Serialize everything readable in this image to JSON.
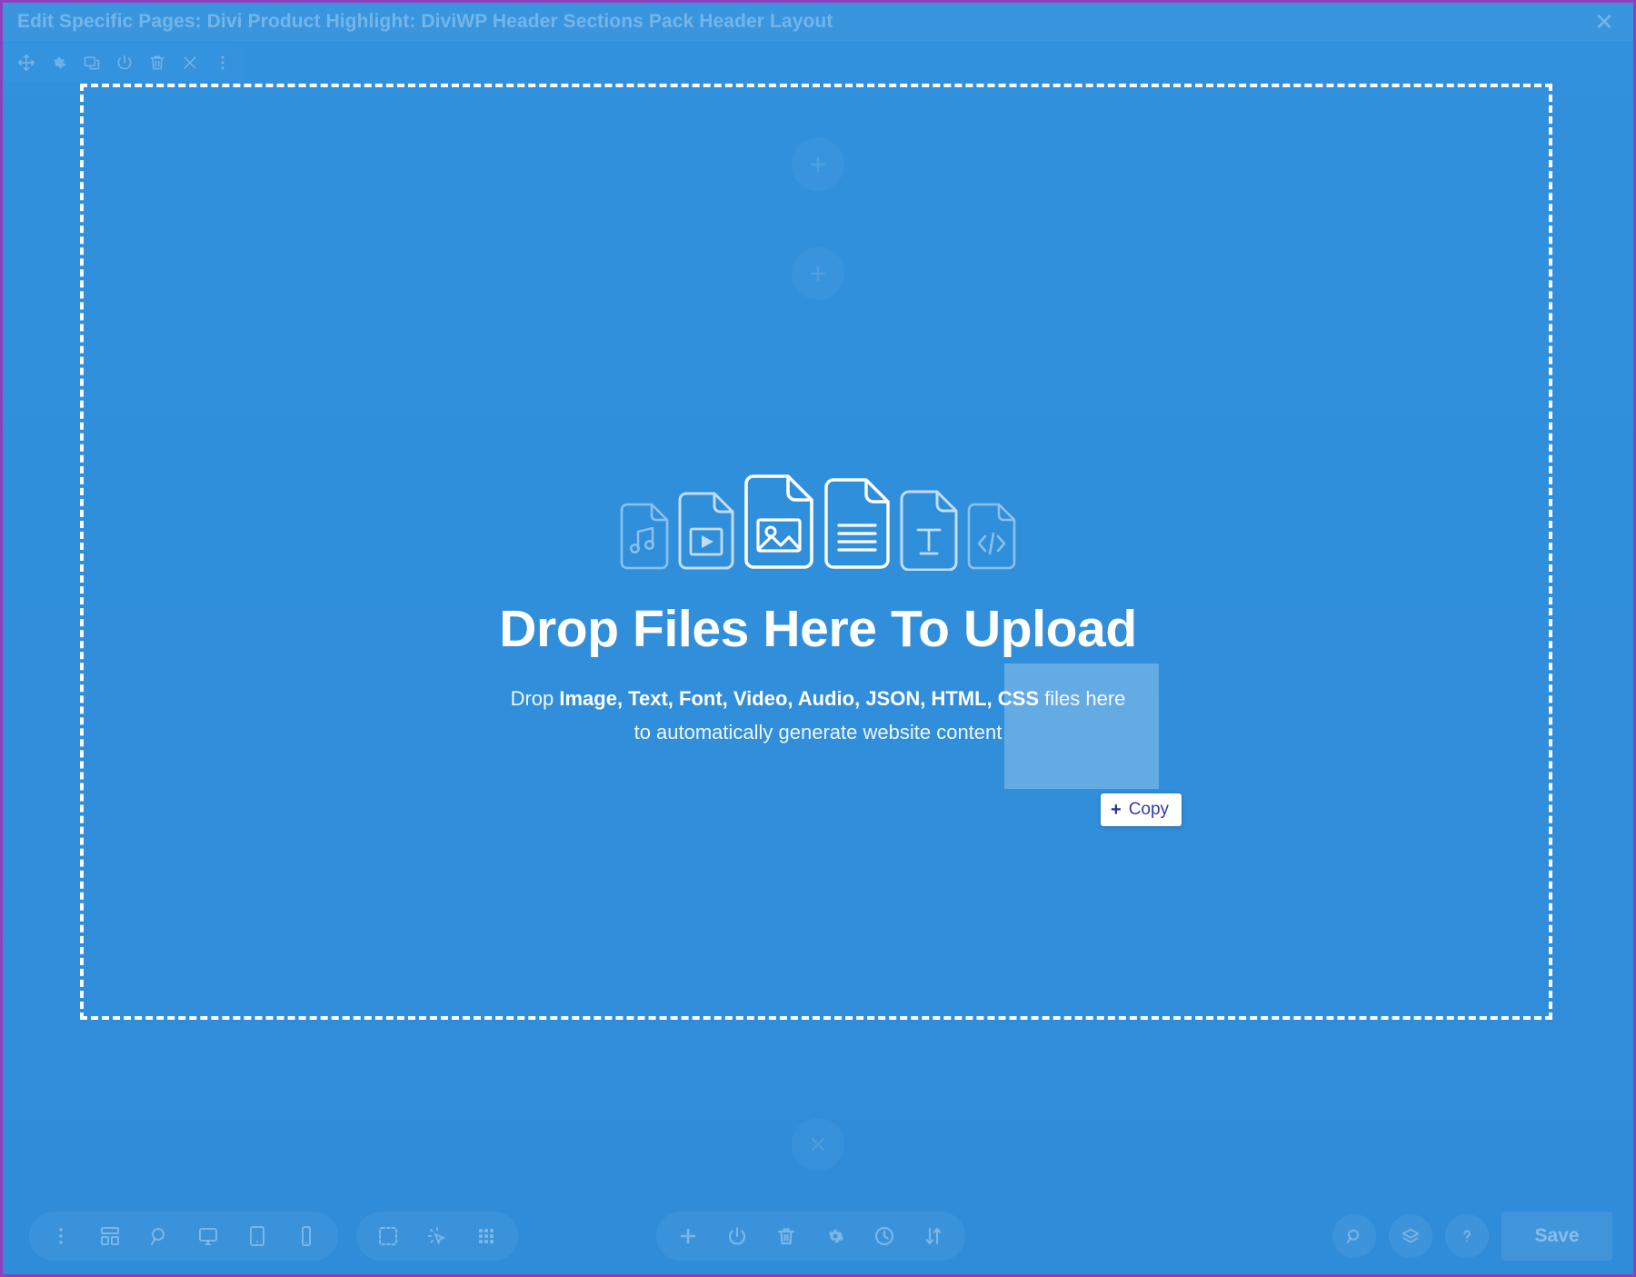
{
  "window": {
    "title": "Edit Specific Pages: Divi Product Highlight: DiviWP Header Sections Pack Header Layout",
    "close_label": "✕",
    "accent_outline_color": "#8f3fbd",
    "canvas_color": "#3291dd"
  },
  "module_toolbar": {
    "items": [
      {
        "name": "move-icon",
        "label": "Move"
      },
      {
        "name": "gear-icon",
        "label": "Settings"
      },
      {
        "name": "duplicate-icon",
        "label": "Duplicate"
      },
      {
        "name": "power-icon",
        "label": "Disable"
      },
      {
        "name": "trash-icon",
        "label": "Delete"
      },
      {
        "name": "close-icon",
        "label": "Close"
      },
      {
        "name": "more-icon",
        "label": "More Options"
      }
    ]
  },
  "drop_area": {
    "file_types": [
      {
        "name": "audio-file-icon",
        "label": "Audio"
      },
      {
        "name": "video-file-icon",
        "label": "Video"
      },
      {
        "name": "image-file-icon",
        "label": "Image"
      },
      {
        "name": "text-file-icon",
        "label": "Text"
      },
      {
        "name": "font-file-icon",
        "label": "Font"
      },
      {
        "name": "code-file-icon",
        "label": "Code"
      }
    ],
    "headline": "Drop Files Here To Upload",
    "subline_lead": "Drop ",
    "subline_formats": "Image, Text, Font, Video, Audio, JSON, HTML, CSS",
    "subline_tail": " files here",
    "subline_second": "to automatically generate website content",
    "formats": [
      "Image",
      "Text",
      "Font",
      "Video",
      "Audio",
      "JSON",
      "HTML",
      "CSS"
    ]
  },
  "drag_tooltip": {
    "plus": "+",
    "label": "Copy"
  },
  "hints": {
    "add_top": "+",
    "add_mid": "+",
    "remove_bottom": "✕"
  },
  "bottom_bar": {
    "view_group": [
      {
        "name": "more-vertical-icon",
        "label": "More"
      },
      {
        "name": "wireframe-icon",
        "label": "Wireframe View"
      },
      {
        "name": "zoom-icon",
        "label": "Zoom Out View"
      },
      {
        "name": "desktop-icon",
        "label": "Desktop View"
      },
      {
        "name": "tablet-icon",
        "label": "Tablet View"
      },
      {
        "name": "phone-icon",
        "label": "Phone View"
      }
    ],
    "select_group": [
      {
        "name": "multiselect-icon",
        "label": "Multiselect"
      },
      {
        "name": "click-mode-icon",
        "label": "Click Mode"
      },
      {
        "name": "grid-mode-icon",
        "label": "Grid Mode"
      }
    ],
    "action_group": [
      {
        "name": "add-icon",
        "label": "Add Section"
      },
      {
        "name": "power-icon",
        "label": "Disable"
      },
      {
        "name": "trash-icon",
        "label": "Delete"
      },
      {
        "name": "gear-icon",
        "label": "Settings"
      },
      {
        "name": "history-icon",
        "label": "Editing History"
      },
      {
        "name": "sort-icon",
        "label": "Portability"
      }
    ],
    "right_tools": [
      {
        "name": "search-circle-icon",
        "label": "Search"
      },
      {
        "name": "layers-circle-icon",
        "label": "Layers"
      },
      {
        "name": "help-circle-icon",
        "label": "Help"
      }
    ],
    "save_label": "Save"
  }
}
